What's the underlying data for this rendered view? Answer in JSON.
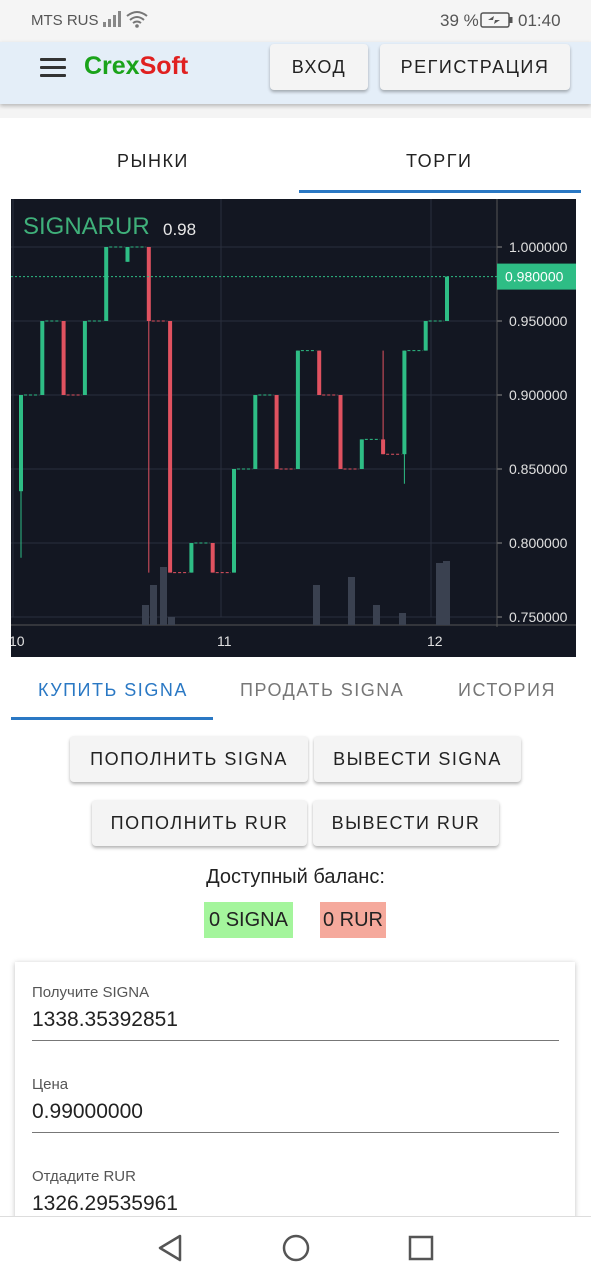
{
  "status": {
    "carrier": "MTS RUS",
    "battery": "39 %",
    "time": "01:40"
  },
  "header": {
    "logo_part1": "Crex",
    "logo_part2": "Soft",
    "login": "ВХОД",
    "register": "РЕГИСТРАЦИЯ"
  },
  "top_tabs": {
    "markets": "РЫНКИ",
    "trades": "ТОРГИ",
    "active": "trades"
  },
  "chart": {
    "symbol": "SIGNARUR",
    "last": "0.98",
    "price_labels": [
      "1.000000",
      "0.950000",
      "0.900000",
      "0.850000",
      "0.800000",
      "0.750000"
    ],
    "current_price_label": "0.980000",
    "time_labels": [
      "10",
      "11",
      "12"
    ],
    "colors": {
      "up": "#2ebd85",
      "down": "#e05260",
      "background": "#131722"
    }
  },
  "chart_data": {
    "type": "candlestick",
    "title": "SIGNARUR",
    "ylim": [
      0.75,
      1.0
    ],
    "ylabel_ticks": [
      1.0,
      0.95,
      0.9,
      0.85,
      0.8,
      0.75
    ],
    "x_ticks": [
      "10",
      "11",
      "12"
    ],
    "last_price": 0.98,
    "candles": [
      {
        "o": 0.835,
        "h": 0.88,
        "l": 0.79,
        "c": 0.9
      },
      {
        "o": 0.9,
        "h": 0.95,
        "l": 0.9,
        "c": 0.95
      },
      {
        "o": 0.95,
        "h": 0.95,
        "l": 0.9,
        "c": 0.9
      },
      {
        "o": 0.9,
        "h": 0.95,
        "l": 0.9,
        "c": 0.95
      },
      {
        "o": 0.95,
        "h": 1.0,
        "l": 0.95,
        "c": 1.0
      },
      {
        "o": 0.99,
        "h": 1.0,
        "l": 0.99,
        "c": 1.0
      },
      {
        "o": 1.0,
        "h": 1.0,
        "l": 0.78,
        "c": 0.95
      },
      {
        "o": 0.95,
        "h": 0.95,
        "l": 0.78,
        "c": 0.78
      },
      {
        "o": 0.78,
        "h": 0.8,
        "l": 0.78,
        "c": 0.8
      },
      {
        "o": 0.8,
        "h": 0.8,
        "l": 0.78,
        "c": 0.78
      },
      {
        "o": 0.78,
        "h": 0.85,
        "l": 0.78,
        "c": 0.85
      },
      {
        "o": 0.85,
        "h": 0.9,
        "l": 0.85,
        "c": 0.9
      },
      {
        "o": 0.9,
        "h": 0.9,
        "l": 0.85,
        "c": 0.85
      },
      {
        "o": 0.85,
        "h": 0.93,
        "l": 0.85,
        "c": 0.93
      },
      {
        "o": 0.93,
        "h": 0.93,
        "l": 0.9,
        "c": 0.9
      },
      {
        "o": 0.9,
        "h": 0.9,
        "l": 0.85,
        "c": 0.85
      },
      {
        "o": 0.85,
        "h": 0.87,
        "l": 0.85,
        "c": 0.87
      },
      {
        "o": 0.87,
        "h": 0.93,
        "l": 0.86,
        "c": 0.86
      },
      {
        "o": 0.86,
        "h": 0.93,
        "l": 0.84,
        "c": 0.93
      },
      {
        "o": 0.93,
        "h": 0.95,
        "l": 0.93,
        "c": 0.95
      },
      {
        "o": 0.95,
        "h": 0.98,
        "l": 0.95,
        "c": 0.98
      }
    ]
  },
  "trade_tabs": {
    "buy": "КУПИТЬ SIGNA",
    "sell": "ПРОДАТЬ SIGNA",
    "history": "ИСТОРИЯ",
    "active": "buy"
  },
  "actions": {
    "deposit_signa": "ПОПОЛНИТЬ SIGNA",
    "withdraw_signa": "ВЫВЕСТИ SIGNA",
    "deposit_rur": "ПОПОЛНИТЬ RUR",
    "withdraw_rur": "ВЫВЕСТИ RUR"
  },
  "balance": {
    "label": "Доступный баланс:",
    "signa": "0 SIGNA",
    "rur": "0 RUR"
  },
  "form": {
    "receive_label": "Получите SIGNA",
    "receive_value": "1338.35392851",
    "price_label": "Цена",
    "price_value": "0.99000000",
    "give_label": "Отдадите RUR",
    "give_value": "1326.29535961"
  }
}
